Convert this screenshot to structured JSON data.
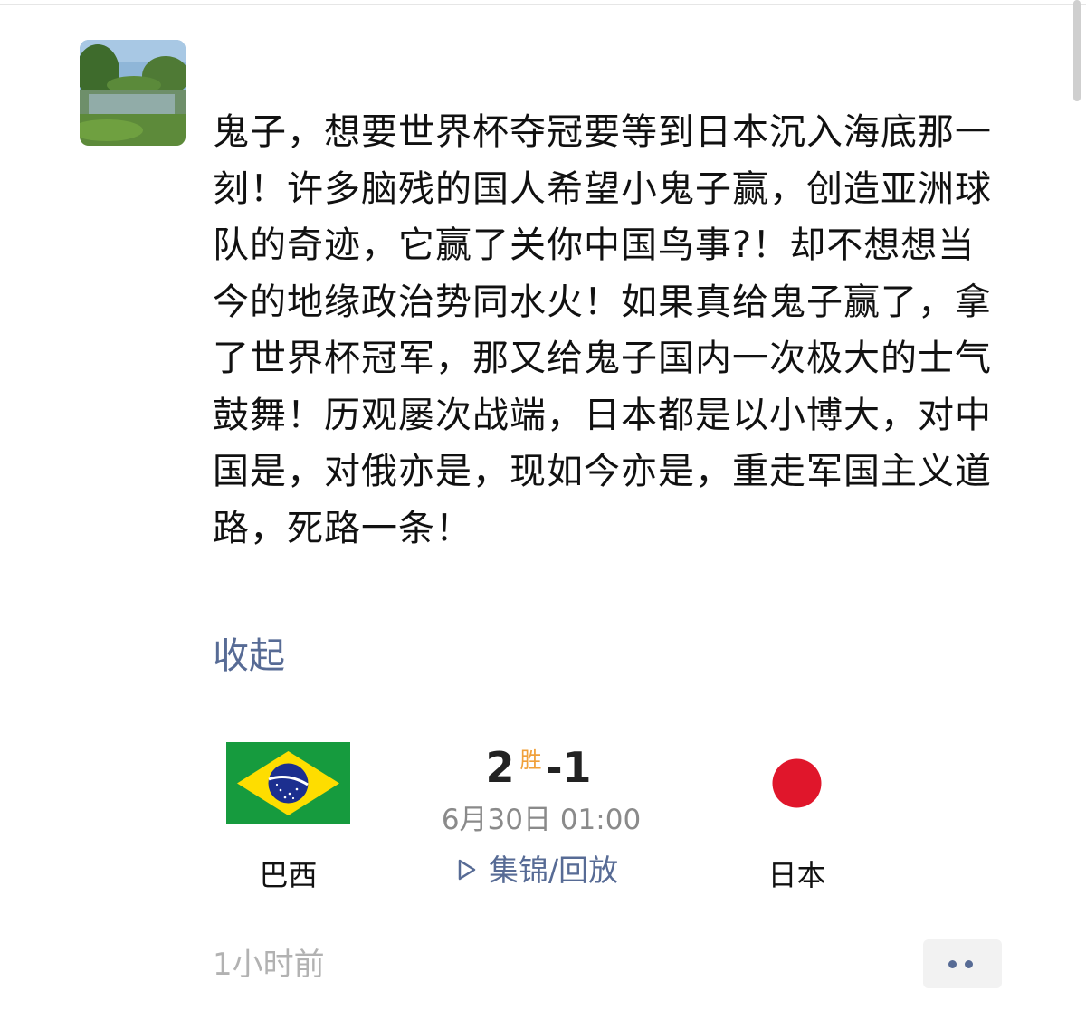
{
  "post": {
    "text": "鬼子，想要世界杯夺冠要等到日本沉入海底那一刻！许多脑残的国人希望小鬼子赢，创造亚洲球队的奇迹，它赢了关你中国鸟事?！却不想想当今的地缘政治势同水火！如果真给鬼子赢了，拿了世界杯冠军，那又给鬼子国内一次极大的士气鼓舞！历观屡次战端，日本都是以小博大，对中国是，对俄亦是，现如今亦是，重走军国主义道路，死路一条！",
    "collapse_label": "收起",
    "timestamp": "1小时前"
  },
  "match": {
    "home_team": "巴西",
    "away_team": "日本",
    "home_score": "2",
    "result_label": "胜",
    "separator": "-",
    "away_score": "1",
    "datetime": "6月30日 01:00",
    "replay_label": "集锦/回放"
  },
  "icons": {
    "avatar": "landscape-photo",
    "home_flag": "brazil-flag",
    "away_flag": "japan-flag",
    "replay": "play-icon",
    "more": "more-dots-icon"
  },
  "colors": {
    "link": "#576b95",
    "win_badge": "#f0a03a",
    "muted": "#8a8a8a",
    "timestamp": "#b2b2b2"
  }
}
